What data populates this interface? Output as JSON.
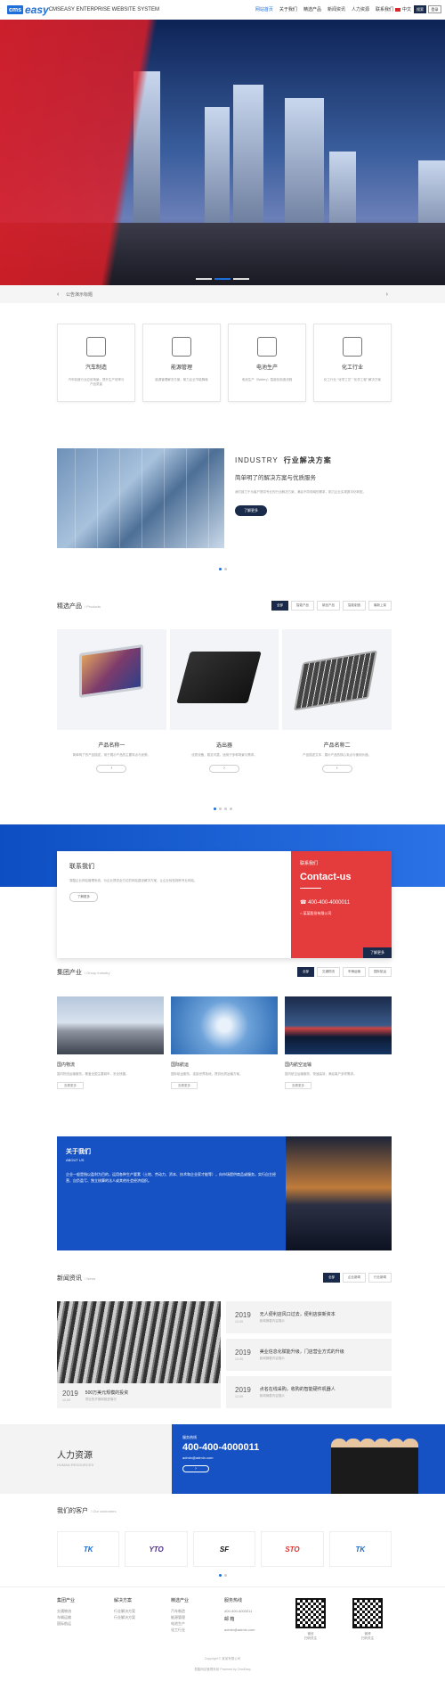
{
  "header": {
    "logo_mark": "cms",
    "logo_text": "easy",
    "logo_sub": "CMSEASY ENTERPRISE WEBSITE SYSTEM",
    "nav": [
      "网站首页",
      "关于我们",
      "精选产品",
      "新闻资讯",
      "人力资源",
      "联系我们"
    ],
    "lang": "中文",
    "search": "搜索",
    "login": "登录"
  },
  "notice": {
    "text": "公告演示标题"
  },
  "cards": [
    {
      "title": "汽车制造",
      "icon": "bus-icon",
      "desc": "汽车制造行业应用场景，提升生产效率与产品质量"
    },
    {
      "title": "能源管理",
      "icon": "factory-icon",
      "desc": "能源管理解决方案，助力企业节能降耗"
    },
    {
      "title": "电池生产",
      "icon": "battery-icon",
      "desc": "电池生产（Battery）智能化制造流程"
    },
    {
      "title": "化工行业",
      "icon": "chemical-icon",
      "desc": "化工行业 \"化学工艺\" \"化学工程\" 解决方案"
    }
  ],
  "industry": {
    "en": "INDUSTRY",
    "cn": "行业解决方案",
    "subtitle": "简单明了的解决方案与优质服务",
    "desc": "我们致力于为客户提供专业的行业解决方案，满足不同领域的需求，助力企业实现数字化转型。",
    "more": "了解更多"
  },
  "products": {
    "title": "精选产品",
    "en": "/ Products",
    "tabs": [
      "全部",
      "智能产品",
      "新品产品",
      "智能制造",
      "最新上架"
    ],
    "items": [
      {
        "name": "产品名称一",
        "desc": "简单明了的产品描述，用于展示产品的主要特点与优势。"
      },
      {
        "name": "选出器",
        "desc": "优质设备，稳定可靠，适用于多种场景与需求。"
      },
      {
        "name": "产品名称二",
        "desc": "产品描述文本，展示产品的核心卖点与使用价值。"
      }
    ]
  },
  "contact": {
    "title": "联系我们",
    "desc": "易酷企业网站管理系统，为企业提供全方位的网站建设解决方案，让企业轻松拥有专业网站。",
    "more": "了解更多",
    "r_label": "联系我们",
    "r_title": "Contact-us",
    "phone": "400-400-4000011",
    "company": "某某股份有限公司",
    "r_more": "了解更多"
  },
  "group": {
    "title": "集团产业",
    "en": "/ Group industry",
    "tabs": [
      "全部",
      "交通物流",
      "车辆运输",
      "国际航运"
    ],
    "items": [
      {
        "name": "国内物流",
        "desc": "国内物流运输服务，覆盖全国主要城市，安全快捷。",
        "more": "查看更多"
      },
      {
        "name": "国际航运",
        "desc": "国际航运服务，连接世界各地，提供优质运输方案。",
        "more": "查看更多"
      },
      {
        "name": "国内航空运输",
        "desc": "国内航空运输服务，快速高效，满足客户多样需求。",
        "more": "查看更多"
      }
    ]
  },
  "about": {
    "title": "关于我们",
    "en": "ABOUT US",
    "desc": "企业一般是指以盈利为目的，运用各种生产要素（土地、劳动力、资本、技术和企业家才能等），向市场提供商品或服务，实行自主经营、自负盈亏、独立核算的法人或其他社会经济组织。"
  },
  "news": {
    "title": "新闻资讯",
    "en": "/ News",
    "tabs": [
      "全部",
      "企业新闻",
      "行业新闻"
    ],
    "big": {
      "year": "2019",
      "date": "12-09",
      "title": "500万美元规模的投资",
      "desc": "项目的开展和推进情况"
    },
    "list": [
      {
        "year": "2019",
        "date": "12-09",
        "title": "无人便利店风口过去，便利店获新资本",
        "desc": "新闻摘要内容展示"
      },
      {
        "year": "2019",
        "date": "12-09",
        "title": "美业信息化赋能升级，门店营业方式的升级",
        "desc": "新闻摘要内容展示"
      },
      {
        "year": "2019",
        "date": "12-09",
        "title": "点名在线采购，收购的智能硬件机器人",
        "desc": "新闻摘要内容展示"
      }
    ]
  },
  "hr": {
    "title": "人力资源",
    "en": "HUMAN RESOURCES",
    "label": "服务热线",
    "phone": "400-400-4000011",
    "email": "admin@admin.com",
    "btn": "›"
  },
  "clients": {
    "title": "我们的客户",
    "en": "/ Our customers",
    "logos": [
      "TK",
      "YTO",
      "SF",
      "STO",
      "TK"
    ]
  },
  "footer": {
    "cols": [
      {
        "h": "集团产业",
        "items": [
          "交通物流",
          "车辆运输",
          "国际航运"
        ]
      },
      {
        "h": "解决方案",
        "items": [
          "行业解决方案",
          "行业解决方案"
        ]
      },
      {
        "h": "精选产业",
        "items": [
          "汽车制造",
          "能源管理",
          "电池生产",
          "化工行业"
        ]
      }
    ],
    "service_h": "服务热线",
    "service_phone": "400-400-4000011",
    "email_h": "邮 箱",
    "email": "admin@admin.com",
    "qr1": "微信",
    "qr1b": "扫码关注",
    "qr2": "微博",
    "qr2b": "扫码关注",
    "copy1": "Copyright © 某某有限公司",
    "copy2": "易酷网站管理系统  Powered by CmsEasy"
  }
}
